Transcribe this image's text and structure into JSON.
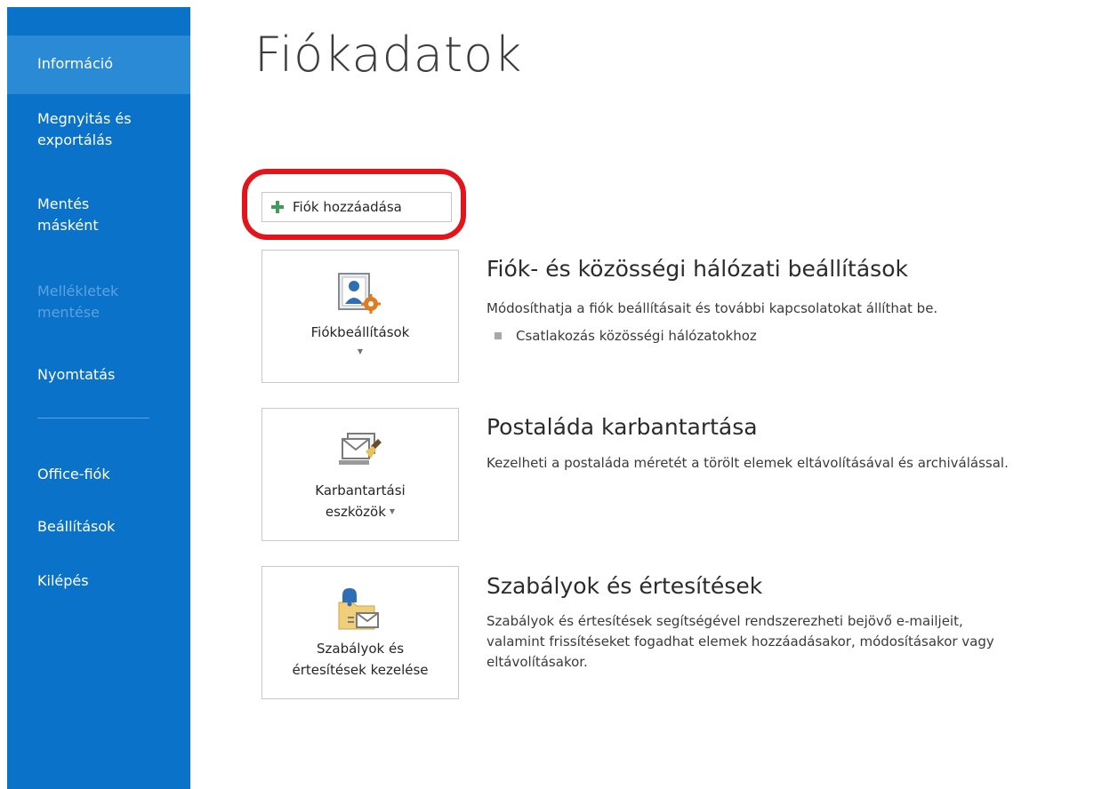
{
  "sidebar": {
    "items": [
      {
        "label": "Információ",
        "state": "active"
      },
      {
        "label": "Megnyitás és exportálás",
        "state": "normal"
      },
      {
        "label": "Mentés másként",
        "state": "normal"
      },
      {
        "label": "Mellékletek mentése",
        "state": "disabled"
      },
      {
        "label": "Nyomtatás",
        "state": "normal"
      },
      {
        "label": "Office-fiók",
        "state": "normal"
      },
      {
        "label": "Beállítások",
        "state": "normal"
      },
      {
        "label": "Kilépés",
        "state": "normal"
      }
    ],
    "lines": {
      "open_export": [
        "Megnyitás és",
        "exportálás"
      ],
      "save_as": [
        "Mentés",
        "másként"
      ],
      "save_attachments": [
        "Mellékletek",
        "mentése"
      ]
    }
  },
  "page": {
    "title": "Fiókadatok"
  },
  "add_account": {
    "label": "Fiók hozzáadása",
    "highlight_color": "#e4141b"
  },
  "sections": {
    "account_settings": {
      "tile_label": "Fiókbeállítások",
      "title": "Fiók- és közösségi hálózati beállítások",
      "description": "Módosíthatja a fiók beállításait és további kapcsolatokat állíthat be.",
      "bullet": "Csatlakozás közösségi hálózatokhoz"
    },
    "mailbox": {
      "tile_label_line1": "Karbantartási",
      "tile_label_line2": "eszközök",
      "title": "Postaláda karbantartása",
      "description": "Kezelheti a postaláda méretét a törölt elemek eltávolításával és archiválással."
    },
    "rules": {
      "tile_label_line1": "Szabályok és",
      "tile_label_line2": "értesítések kezelése",
      "title": "Szabályok és értesítések",
      "description_lines": [
        "Szabályok és értesítések segítségével rendszerezheti bejövő e-mailjeit,",
        "valamint frissítéseket fogadhat elemek hozzáadásakor, módosításakor vagy",
        "eltávolításakor."
      ]
    }
  },
  "colors": {
    "sidebar_bg": "#0a72c9",
    "sidebar_active": "#2a8ad6",
    "accent_green": "#3f9a5b"
  }
}
